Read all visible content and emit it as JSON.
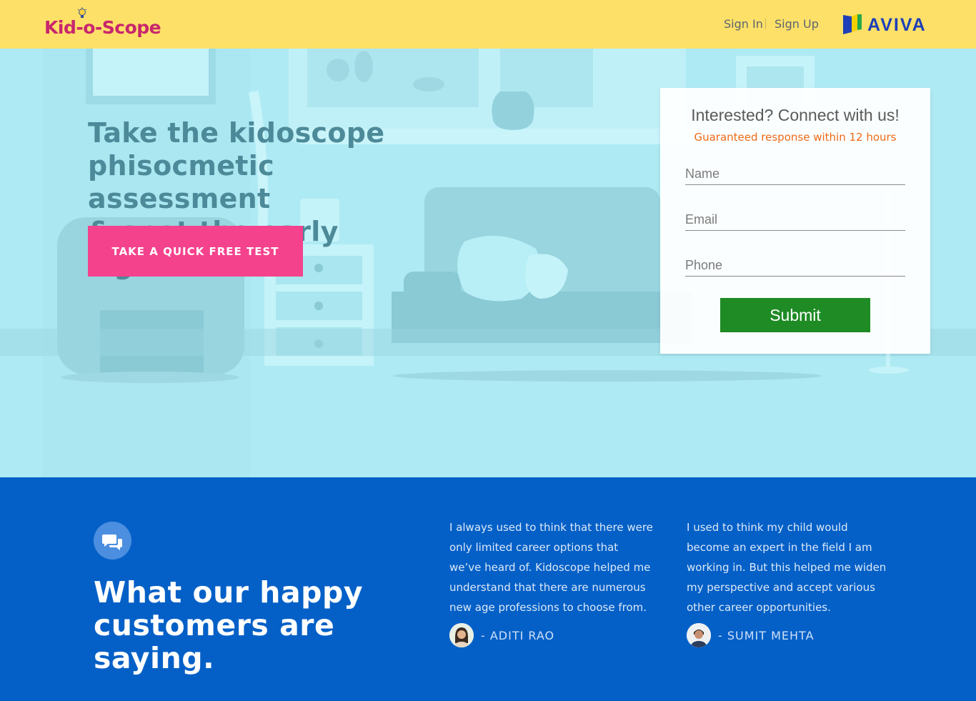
{
  "header": {
    "logo_text": "Kid-o-Scope",
    "nav": {
      "sign_in": "Sign In",
      "sign_up": "Sign Up"
    },
    "partner_logo_text": "AVIVA"
  },
  "hero": {
    "title_lines": [
      "Take the kidoscope",
      "phisocmetic assessment",
      "& spot the early signs."
    ],
    "cta_label": "TAKE A QUICK FREE TEST"
  },
  "form": {
    "title": "Interested? Connect with us!",
    "subtitle": "Guaranteed response within 12 hours",
    "name_placeholder": "Name",
    "email_placeholder": "Email",
    "phone_placeholder": "Phone",
    "submit_label": "Submit"
  },
  "testimonials": {
    "heading_lines": [
      "What our happy",
      "customers are saying."
    ],
    "items": [
      {
        "quote": "I always used to think that there were only limited career options that we’ve heard of. Kidoscope helped me understand  that there are numerous new age professions to choose from.",
        "author": "- ADITI RAO"
      },
      {
        "quote": "I used to think my child would become an expert in the field I am working in. But this helped me widen my perspective and accept various other career opportunities.",
        "author": "- SUMIT MEHTA"
      }
    ]
  },
  "colors": {
    "header_bg": "#fde068",
    "hero_bg": "#aeeaf3",
    "cta_bg": "#f5428c",
    "submit_bg": "#1e8b24",
    "testimonial_bg": "#0460c7",
    "subtitle_color": "#ee6a16"
  },
  "icons": [
    "lightbulb-icon",
    "aviva-logo-icon",
    "chat-bubbles-icon"
  ]
}
